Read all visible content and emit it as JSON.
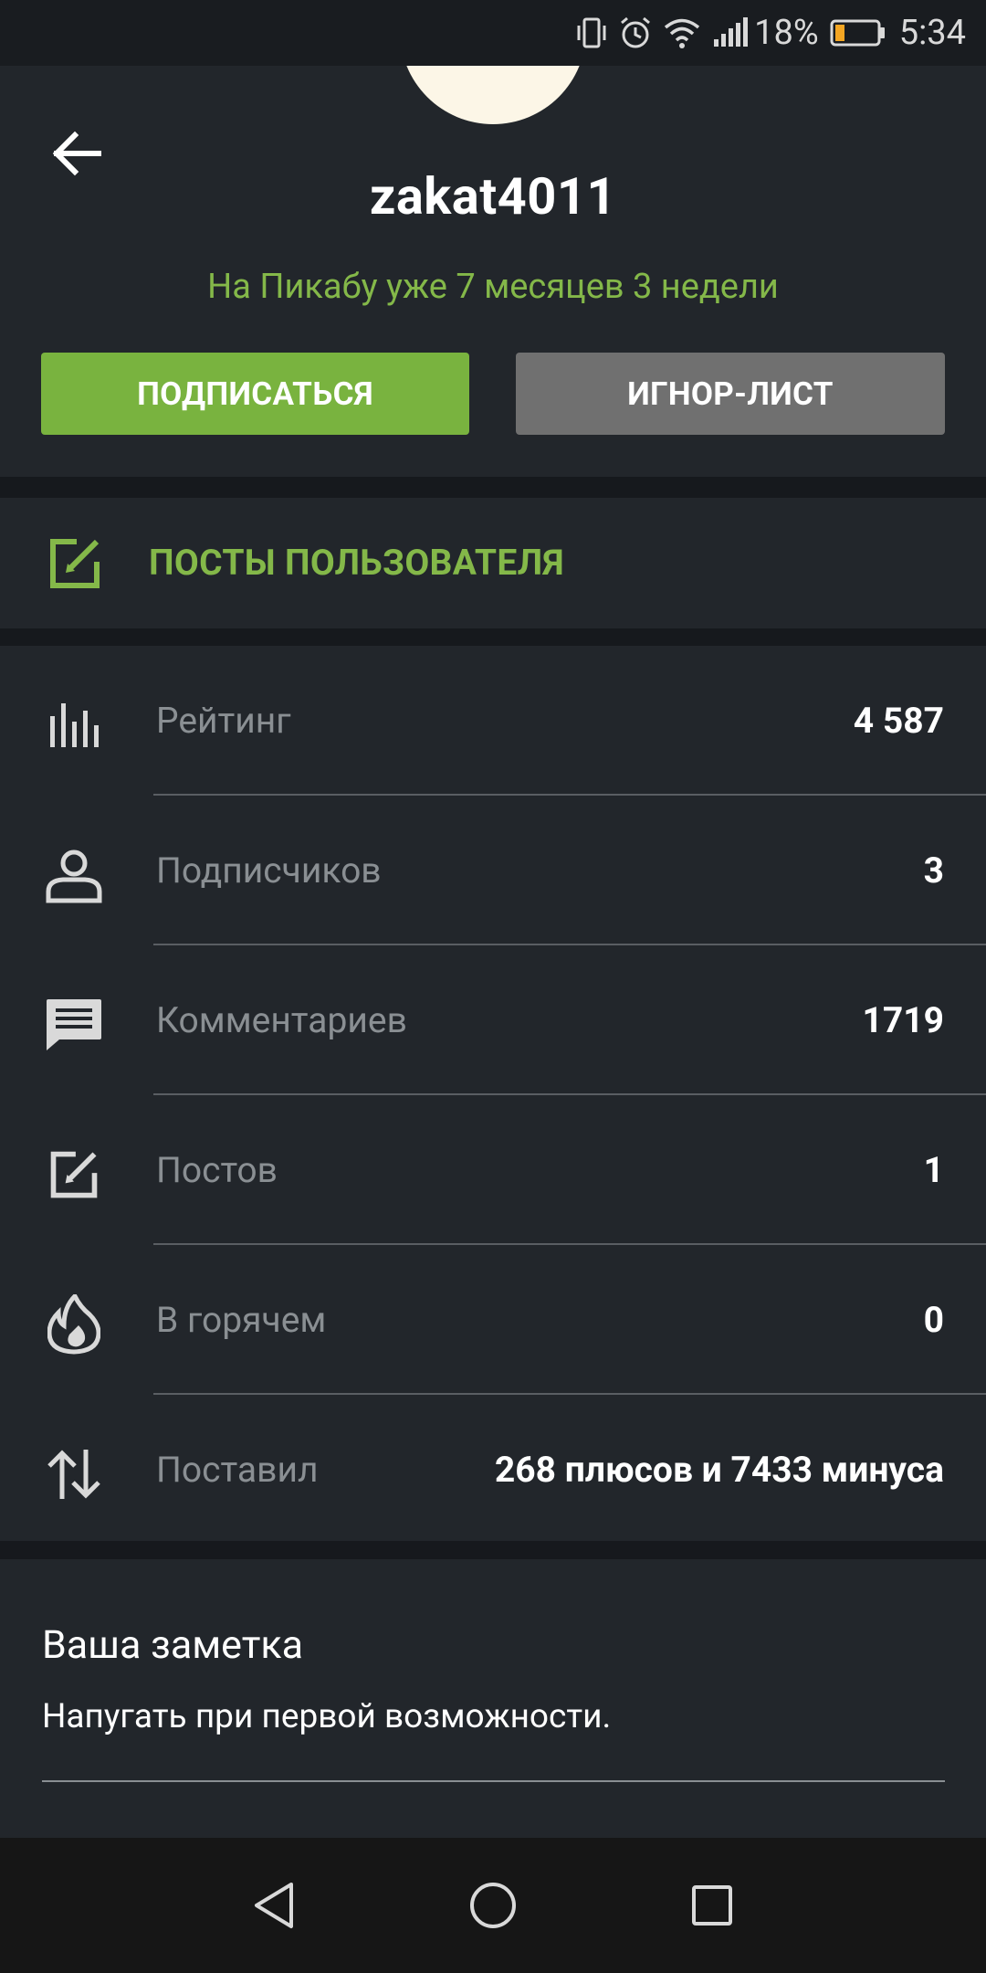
{
  "status_bar": {
    "battery_percent": "18%",
    "time": "5:34",
    "icons": [
      "vibrate-icon",
      "alarm-icon",
      "wifi-icon",
      "signal-icon",
      "battery-icon"
    ]
  },
  "profile": {
    "username": "zakat4011",
    "member_since": "На Пикабу уже 7 месяцев 3 недели",
    "subscribe_label": "ПОДПИСАТЬСЯ",
    "ignore_label": "ИГНОР-ЛИСТ"
  },
  "posts_section": {
    "label": "ПОСТЫ ПОЛЬЗОВАТЕЛЯ",
    "icon": "edit-icon"
  },
  "stats": [
    {
      "label": "Рейтинг",
      "value": "4 587",
      "icon": "rating-bars-icon"
    },
    {
      "label": "Подписчиков",
      "value": "3",
      "icon": "user-icon"
    },
    {
      "label": "Комментариев",
      "value": "1719",
      "icon": "comment-icon"
    },
    {
      "label": "Постов",
      "value": "1",
      "icon": "edit-icon"
    },
    {
      "label": "В горячем",
      "value": "0",
      "icon": "flame-icon"
    },
    {
      "label": "Поставил",
      "value": "268 плюсов и 7433 минуса",
      "icon": "up-down-arrows-icon"
    }
  ],
  "note": {
    "title": "Ваша заметка",
    "text": "Напугать при первой возможности."
  },
  "colors": {
    "background": "#22262b",
    "accent_green": "#79b33f",
    "text_green": "#84b849",
    "ignore_gray": "#707070",
    "label_gray": "#8a8f93"
  }
}
